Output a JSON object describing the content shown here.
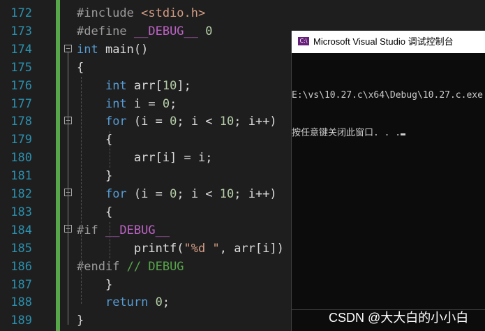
{
  "editor": {
    "lines": [
      {
        "num": "172",
        "parts": [
          [
            "pp",
            "#include "
          ],
          [
            "str",
            "<stdio.h>"
          ]
        ]
      },
      {
        "num": "173",
        "parts": [
          [
            "pp",
            "#define "
          ],
          [
            "macro",
            "__DEBUG__"
          ],
          [
            "ident",
            " "
          ],
          [
            "num",
            "0"
          ]
        ]
      },
      {
        "num": "174",
        "parts": [
          [
            "kw",
            "int"
          ],
          [
            "ident",
            " main()"
          ]
        ]
      },
      {
        "num": "175",
        "parts": [
          [
            "ident",
            "{"
          ]
        ]
      },
      {
        "num": "176",
        "parts": [
          [
            "ident",
            "    "
          ],
          [
            "kw",
            "int"
          ],
          [
            "ident",
            " arr["
          ],
          [
            "num",
            "10"
          ],
          [
            "ident",
            "];"
          ]
        ]
      },
      {
        "num": "177",
        "parts": [
          [
            "ident",
            "    "
          ],
          [
            "kw",
            "int"
          ],
          [
            "ident",
            " i = "
          ],
          [
            "num",
            "0"
          ],
          [
            "ident",
            ";"
          ]
        ]
      },
      {
        "num": "178",
        "parts": [
          [
            "ident",
            "    "
          ],
          [
            "kw",
            "for"
          ],
          [
            "ident",
            " (i = "
          ],
          [
            "num",
            "0"
          ],
          [
            "ident",
            "; i < "
          ],
          [
            "num",
            "10"
          ],
          [
            "ident",
            "; i++)"
          ]
        ]
      },
      {
        "num": "179",
        "parts": [
          [
            "ident",
            "    {"
          ]
        ]
      },
      {
        "num": "180",
        "parts": [
          [
            "ident",
            "        arr[i] = i;"
          ]
        ]
      },
      {
        "num": "181",
        "parts": [
          [
            "ident",
            "    }"
          ]
        ]
      },
      {
        "num": "182",
        "parts": [
          [
            "ident",
            "    "
          ],
          [
            "kw",
            "for"
          ],
          [
            "ident",
            " (i = "
          ],
          [
            "num",
            "0"
          ],
          [
            "ident",
            "; i < "
          ],
          [
            "num",
            "10"
          ],
          [
            "ident",
            "; i++)"
          ]
        ]
      },
      {
        "num": "183",
        "parts": [
          [
            "ident",
            "    {"
          ]
        ]
      },
      {
        "num": "184",
        "parts": [
          [
            "pp",
            "#if "
          ],
          [
            "macro",
            "__DEBUG__"
          ]
        ]
      },
      {
        "num": "185",
        "parts": [
          [
            "ident",
            "        printf("
          ],
          [
            "str",
            "\"%d \""
          ],
          [
            "ident",
            ", arr[i])"
          ]
        ]
      },
      {
        "num": "186",
        "parts": [
          [
            "pp",
            "#endif "
          ],
          [
            "cmt",
            "// DEBUG"
          ]
        ]
      },
      {
        "num": "187",
        "parts": [
          [
            "ident",
            "    }"
          ]
        ]
      },
      {
        "num": "188",
        "parts": [
          [
            "ident",
            "    "
          ],
          [
            "kw",
            "return"
          ],
          [
            "ident",
            " "
          ],
          [
            "num",
            "0"
          ],
          [
            "ident",
            ";"
          ]
        ]
      },
      {
        "num": "189",
        "parts": [
          [
            "ident",
            "}"
          ]
        ]
      }
    ],
    "fold_markers": [
      "−",
      "−",
      "−",
      "−"
    ]
  },
  "console": {
    "title": "Microsoft Visual Studio 调试控制台",
    "icon_label": "C:\\",
    "output_line1": "E:\\vs\\10.27.c\\x64\\Debug\\10.27.c.exe",
    "output_line2": "按任意键关闭此窗口. . ."
  },
  "watermark": "CSDN @大大白的小小白"
}
